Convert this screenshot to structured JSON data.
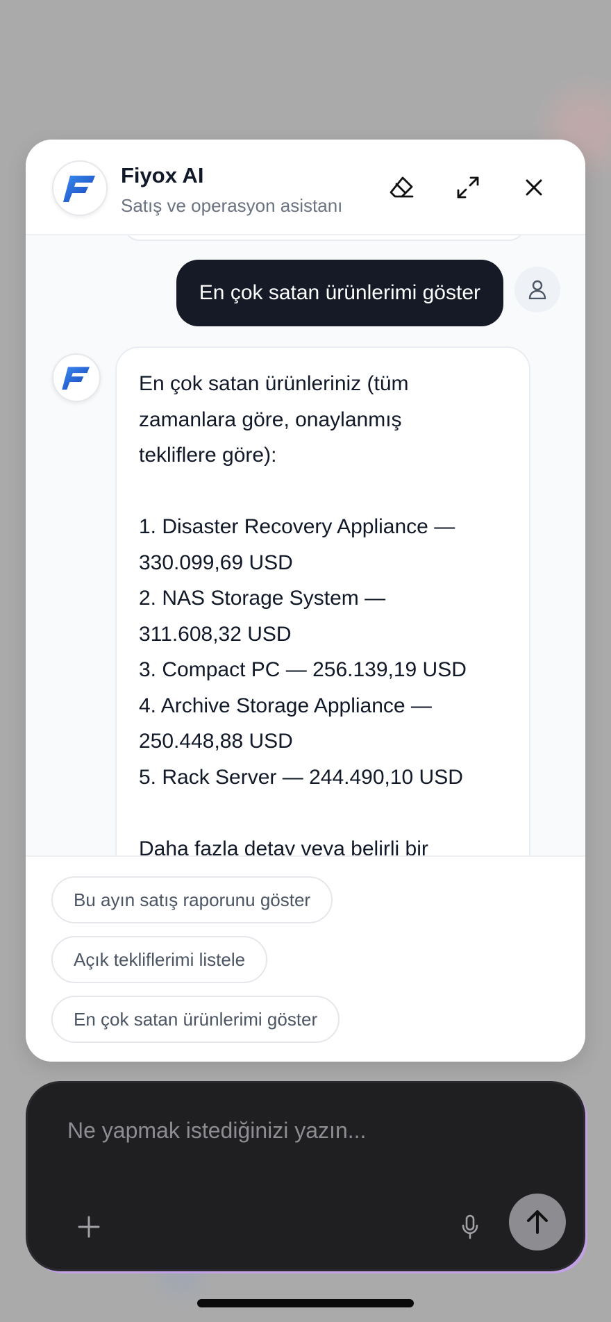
{
  "header": {
    "title": "Fiyox AI",
    "subtitle": "Satış ve operasyon asistanı",
    "logo_icon": "fiyox-logo",
    "actions": [
      "eraser-icon",
      "expand-icon",
      "close-icon"
    ]
  },
  "messages": {
    "user": "En çok satan ürünlerimi göster",
    "bot_lines": [
      "En çok satan ürünleriniz (tüm",
      "zamanlara göre, onaylanmış",
      "tekliflere göre):",
      "",
      "1. Disaster Recovery Appliance —",
      "330.099,69 USD",
      "2. NAS Storage System —",
      "311.608,32 USD",
      "3. Compact PC — 256.139,19 USD",
      "4. Archive Storage Appliance —",
      "250.448,88 USD",
      "5. Rack Server — 244.490,10 USD",
      "",
      "Daha fazla detay veya belirli bir"
    ]
  },
  "suggestions": [
    "Bu ayın satış raporunu göster",
    "Açık tekliflerimi listele",
    "En çok satan ürünlerimi göster"
  ],
  "composer": {
    "placeholder": "Ne yapmak istediğinizi yazın..."
  },
  "colors": {
    "user_bubble": "#151a26",
    "logo_blue": "#1d4fd8",
    "composer_bg": "#1f1f21",
    "send_button": "#8d8d91"
  }
}
